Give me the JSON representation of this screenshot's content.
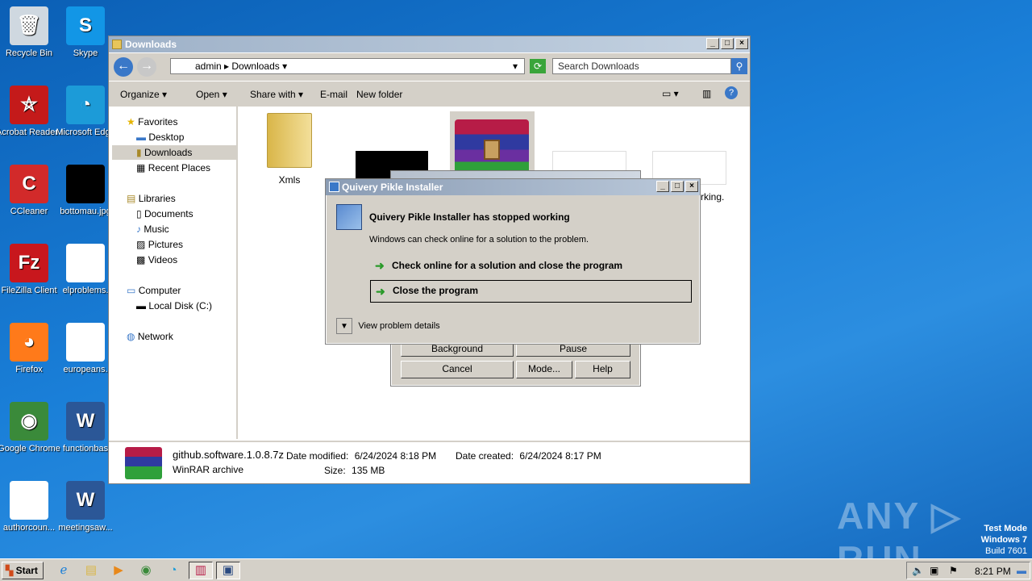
{
  "desktop": {
    "icons": [
      {
        "label": "Recycle Bin",
        "glyph": "🗑",
        "color": "#cfd8e0"
      },
      {
        "label": "Skype",
        "glyph": "S",
        "color": "#1296e6"
      },
      {
        "label": "Acrobat Reader DC",
        "glyph": "⛤",
        "color": "#c41a1a"
      },
      {
        "label": "Microsoft Edge",
        "glyph": "◔",
        "color": "#1c9bd8"
      },
      {
        "label": "CCleaner",
        "glyph": "C",
        "color": "#d22a2a"
      },
      {
        "label": "bottomau.jpg",
        "glyph": "",
        "color": "#000000"
      },
      {
        "label": "FileZilla Client",
        "glyph": "Fz",
        "color": "#c8171d"
      },
      {
        "label": "elproblems.",
        "glyph": "",
        "color": "#ffffff"
      },
      {
        "label": "Firefox",
        "glyph": "◕",
        "color": "#ff7a1a"
      },
      {
        "label": "europeans.",
        "glyph": "",
        "color": "#ffffff"
      },
      {
        "label": "Google Chrome",
        "glyph": "◉",
        "color": "#3a8a3a"
      },
      {
        "label": "functionbas",
        "glyph": "W",
        "color": "#2b5797"
      },
      {
        "label": "authorcoun...",
        "glyph": "",
        "color": "#ffffff"
      },
      {
        "label": "meetingsaw...",
        "glyph": "W",
        "color": "#2b5797"
      }
    ],
    "watermark": "ANY ▷ RUN",
    "mode_lines": [
      "Test Mode",
      "Windows 7",
      "Build 7601"
    ]
  },
  "explorer": {
    "title": "Downloads",
    "address": [
      "admin",
      "Downloads"
    ],
    "search_placeholder": "Search Downloads",
    "toolbar": [
      "Organize",
      "Open",
      "Share with",
      "E-mail",
      "New folder"
    ],
    "nav": {
      "favorites": "Favorites",
      "favorites_items": [
        "Desktop",
        "Downloads",
        "Recent Places"
      ],
      "libraries": "Libraries",
      "libraries_items": [
        "Documents",
        "Music",
        "Pictures",
        "Videos"
      ],
      "computer": "Computer",
      "computer_items": [
        "Local Disk (C:)"
      ],
      "network": "Network"
    },
    "files": [
      {
        "label": "Xmls",
        "kind": "folder"
      },
      {
        "label": "",
        "kind": "black"
      },
      {
        "label": "",
        "kind": "winrar"
      },
      {
        "label": "",
        "kind": "doc"
      },
      {
        "label": "rking.",
        "kind": "doc2"
      }
    ],
    "details": {
      "name": "github.software.1.0.8.7z",
      "type": "WinRAR archive",
      "modified_label": "Date modified:",
      "modified": "6/24/2024 8:18 PM",
      "created_label": "Date created:",
      "created": "6/24/2024 8:17 PM",
      "size_label": "Size:",
      "size": "135 MB"
    }
  },
  "rar_dialog": {
    "buttons": [
      "Background",
      "Pause",
      "Cancel",
      "Mode...",
      "Help"
    ]
  },
  "crash_dialog": {
    "title": "Quivery Pikle Installer",
    "heading": "Quivery Pikle Installer has stopped working",
    "subtext": "Windows can check online for a solution to the problem.",
    "option1": "Check online for a solution and close the program",
    "option2": "Close the program",
    "details": "View problem details"
  },
  "taskbar": {
    "start": "Start",
    "clock": "8:21 PM"
  }
}
